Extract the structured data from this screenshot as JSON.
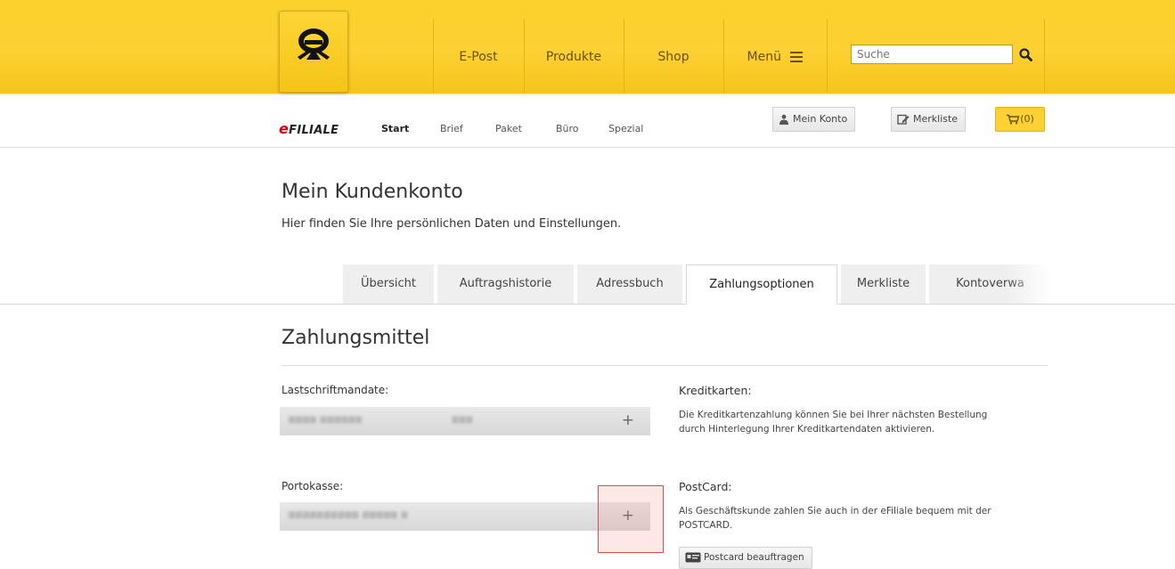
{
  "header": {
    "nav": [
      {
        "label": "E-Post"
      },
      {
        "label": "Produkte"
      },
      {
        "label": "Shop"
      },
      {
        "label": "Menü"
      }
    ],
    "search_placeholder": "Suche",
    "icons": [
      "posthorn-logo-icon",
      "menu-icon",
      "search-icon"
    ]
  },
  "subbar": {
    "brand_e": "e",
    "brand_rest": "FILIALE",
    "nav": [
      {
        "label": "Start"
      },
      {
        "label": "Brief"
      },
      {
        "label": "Paket"
      },
      {
        "label": "Büro"
      },
      {
        "label": "Spezial"
      }
    ],
    "account_label": "Mein Konto",
    "watchlist_label": "Merkliste",
    "cart_count": "(0)"
  },
  "page": {
    "title": "Mein Kundenkonto",
    "subtitle": "Hier finden Sie Ihre persönlichen Daten und Einstellungen."
  },
  "tabs": [
    {
      "label": "Übersicht"
    },
    {
      "label": "Auftragshistorie"
    },
    {
      "label": "Adressbuch"
    },
    {
      "label": "Zahlungsoptionen",
      "active": true
    },
    {
      "label": "Merkliste"
    },
    {
      "label": "Kontoverwa"
    }
  ],
  "section": {
    "title": "Zahlungsmittel",
    "direct_debit": {
      "label": "Lastschriftmandate:",
      "plus": "+"
    },
    "postage_account": {
      "label": "Portokasse:",
      "plus": "+"
    },
    "credit_cards": {
      "title": "Kreditkarten:",
      "text_line1": "Die Kreditkartenzahlung können Sie bei Ihrer nächsten Bestellung",
      "text_line2": "durch Hinterlegung Ihrer Kreditkartendaten aktivieren."
    },
    "postcard": {
      "title": "PostCard:",
      "text_line1": "Als Geschäftskunde zahlen Sie auch in der eFiliale bequem mit der",
      "text_line2": "POSTCARD.",
      "button_label": "Postcard beauftragen"
    }
  },
  "colors": {
    "brand_yellow": "#fdd034",
    "brand_red": "#d40511",
    "highlight_red": "#e04b4b"
  }
}
